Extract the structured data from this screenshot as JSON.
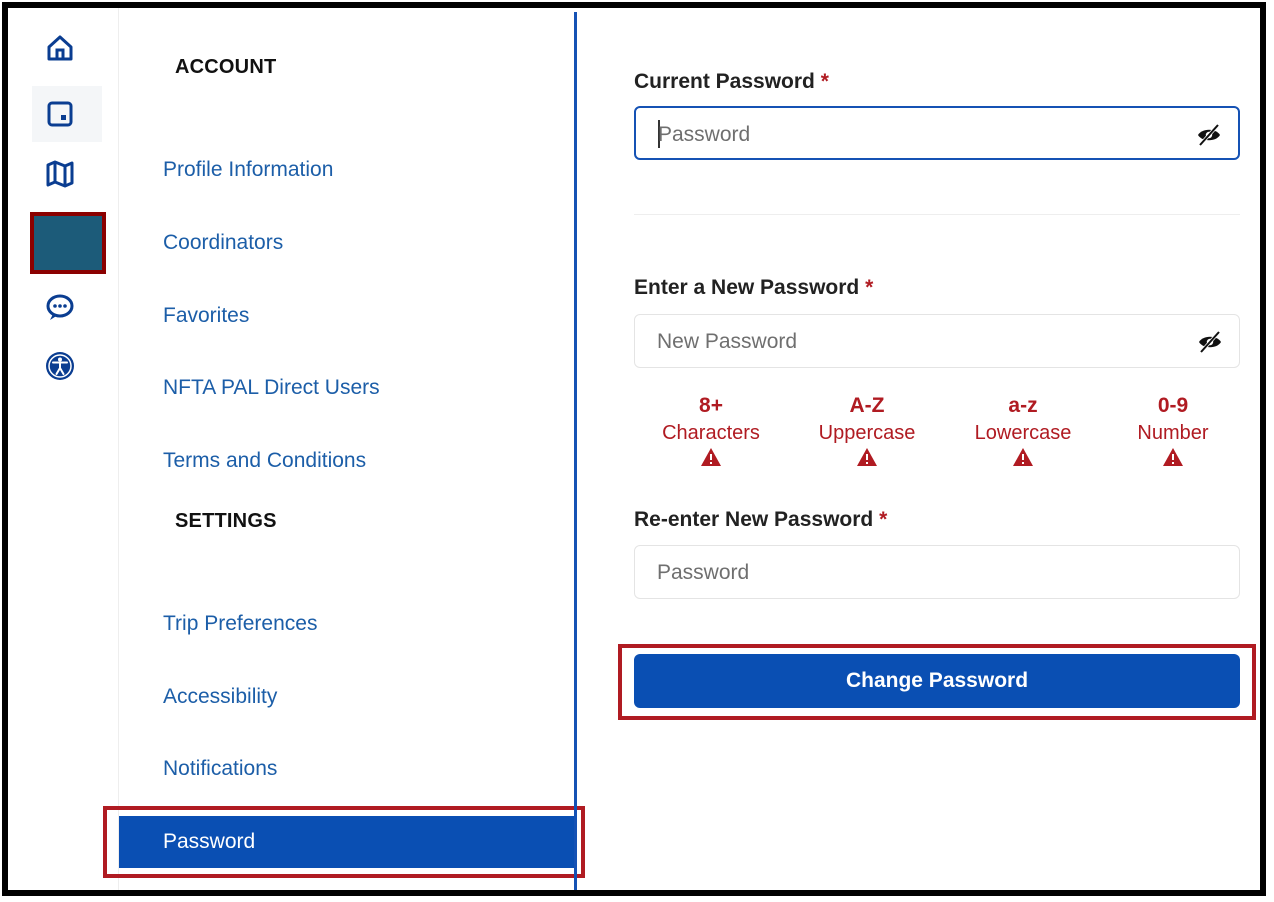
{
  "rail": {
    "icons": [
      "home-icon",
      "calendar-icon",
      "map-icon",
      "account-icon",
      "chat-icon",
      "accessibility-icon"
    ],
    "active_index": 3
  },
  "menu": {
    "account_title": "ACCOUNT",
    "account_items": [
      "Profile Information",
      "Coordinators",
      "Favorites",
      "NFTA PAL Direct Users",
      "Terms and Conditions"
    ],
    "settings_title": "SETTINGS",
    "settings_items": [
      "Trip Preferences",
      "Accessibility",
      "Notifications"
    ],
    "selected_item": "Password"
  },
  "form": {
    "current_password": {
      "label": "Current Password",
      "required": "*",
      "placeholder": "Password"
    },
    "new_password": {
      "label": "Enter a New Password",
      "required": "*",
      "placeholder": "New Password"
    },
    "requirements": [
      {
        "value": "8+",
        "label": "Characters"
      },
      {
        "value": "A-Z",
        "label": "Uppercase"
      },
      {
        "value": "a-z",
        "label": "Lowercase"
      },
      {
        "value": "0-9",
        "label": "Number"
      }
    ],
    "reenter_password": {
      "label": "Re-enter New Password",
      "required": "*",
      "placeholder": "Password"
    },
    "submit_label": "Change Password"
  },
  "colors": {
    "primary": "#0a4fb3",
    "link": "#1c5ea8",
    "error": "#b01b22",
    "highlight_border": "#b01b22",
    "rail_active": "#1c5b79"
  }
}
